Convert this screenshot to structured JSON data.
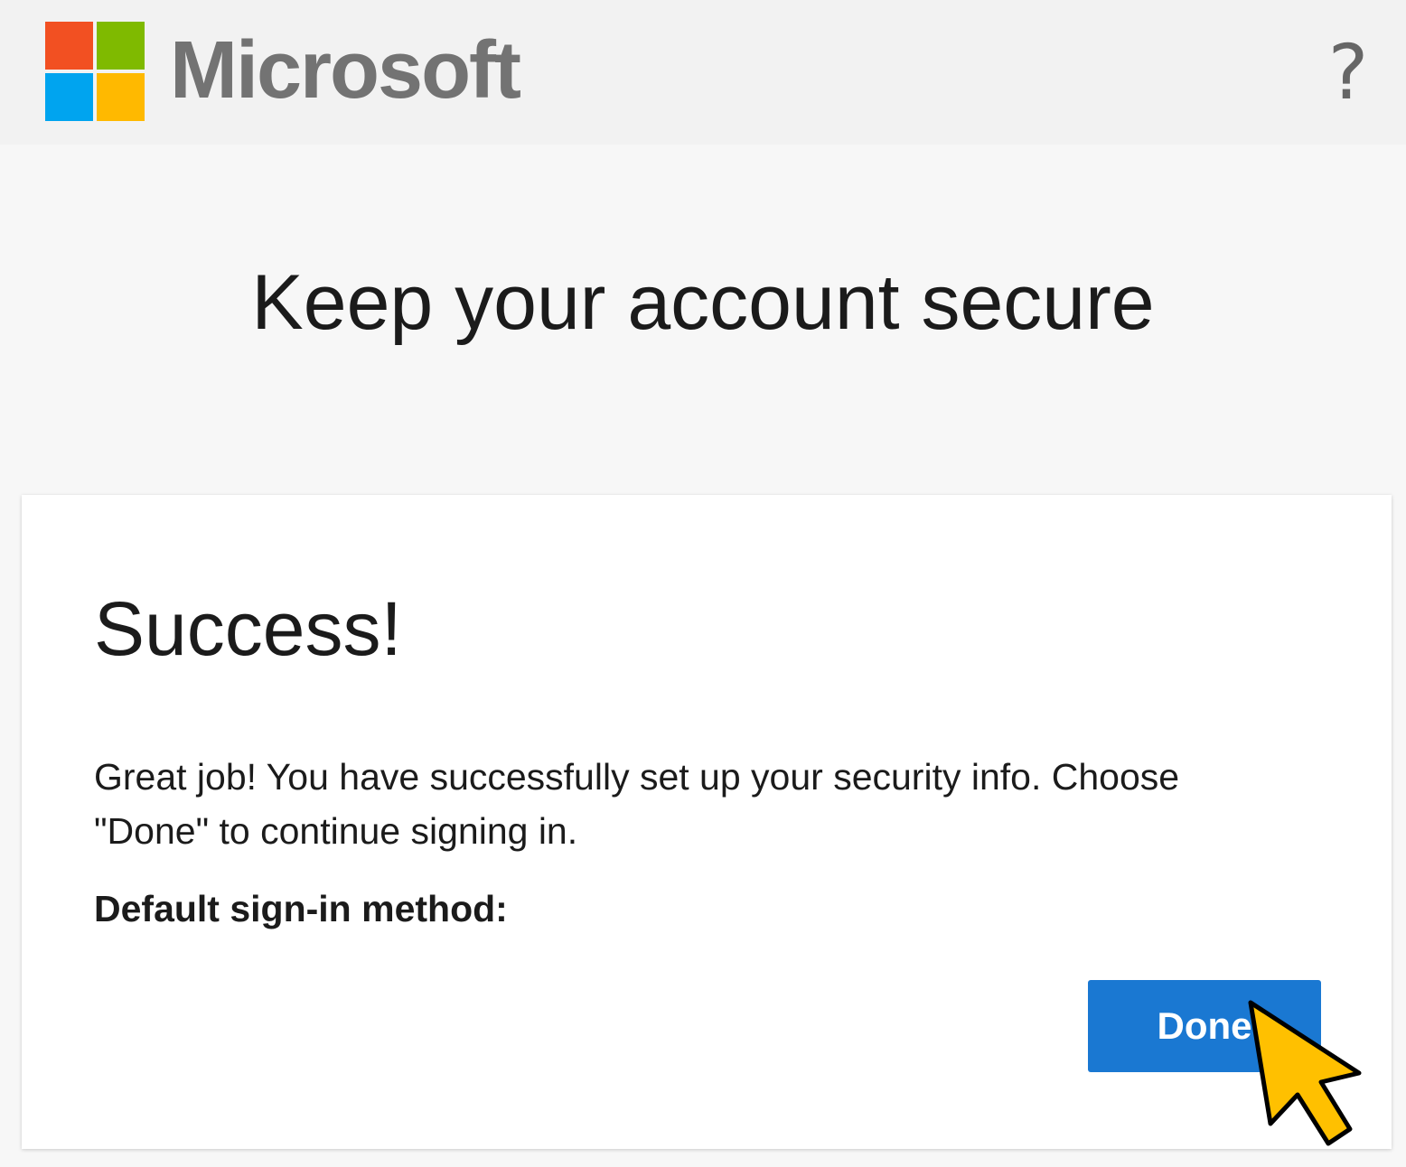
{
  "header": {
    "brand_name": "Microsoft",
    "logo_colors": [
      "#f25022",
      "#7fba00",
      "#00a4ef",
      "#ffb900"
    ],
    "help_icon": "?"
  },
  "main": {
    "title": "Keep your account secure"
  },
  "card": {
    "title": "Success!",
    "message": "Great job! You have successfully set up your security info. Choose \"Done\" to continue signing in.",
    "default_method_label": "Default sign-in method:",
    "done_label": "Done"
  },
  "colors": {
    "accent": "#1a78d2",
    "cursor": "#ffc000"
  }
}
